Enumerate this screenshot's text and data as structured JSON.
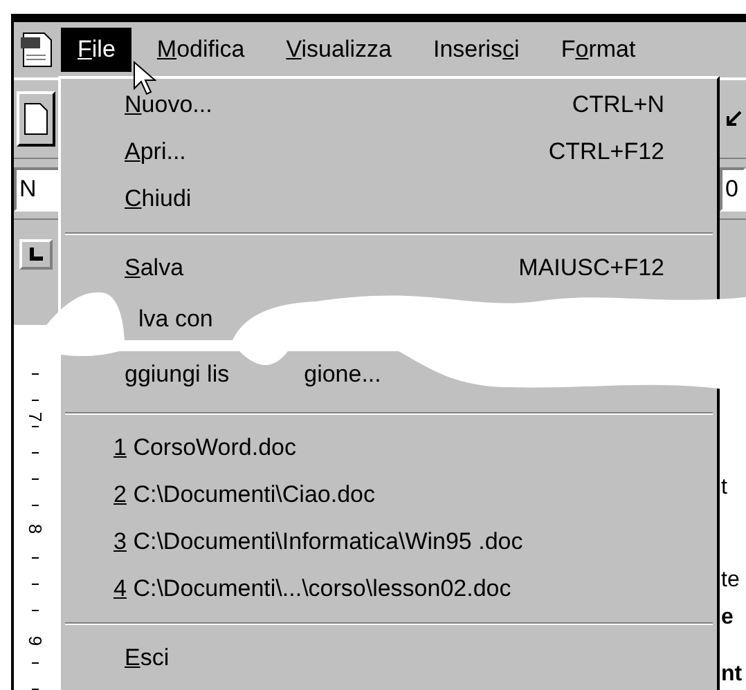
{
  "menubar": {
    "items": [
      {
        "key": "F",
        "after": "ile",
        "selected": true
      },
      {
        "key": "M",
        "after": "odifica",
        "selected": false
      },
      {
        "key": "V",
        "after": "isualizza",
        "selected": false
      },
      {
        "before": "Inseris",
        "key": "c",
        "after": "i",
        "selected": false
      },
      {
        "before": "F",
        "key": "o",
        "after": "rmat",
        "selected": false
      }
    ]
  },
  "file_menu": {
    "items": [
      {
        "kind": "command",
        "key": "N",
        "after": "uovo...",
        "shortcut": "CTRL+N"
      },
      {
        "kind": "command",
        "key": "A",
        "after": "pri...",
        "shortcut": "CTRL+F12"
      },
      {
        "kind": "command",
        "key": "C",
        "after": "hiudi"
      },
      {
        "kind": "separator"
      },
      {
        "kind": "command",
        "key": "S",
        "after": "alva",
        "shortcut": "MAIUSC+F12"
      },
      {
        "kind": "torn",
        "fragments": [
          "lva con"
        ]
      },
      {
        "kind": "torn",
        "fragments": [
          "ggiungi lis",
          "gione..."
        ]
      },
      {
        "kind": "separator"
      },
      {
        "kind": "recent",
        "key": "1",
        "after": " CorsoWord.doc"
      },
      {
        "kind": "recent",
        "key": "2",
        "after": " C:\\Documenti\\Ciao.doc"
      },
      {
        "kind": "recent",
        "key": "3",
        "after": " C:\\Documenti\\Informatica\\Win95 .doc"
      },
      {
        "kind": "recent",
        "key": "4",
        "after": " C:\\Documenti\\...\\corso\\lesson02.doc"
      },
      {
        "kind": "separator"
      },
      {
        "kind": "command",
        "key": "E",
        "after": "sci"
      }
    ]
  },
  "toolbar": {
    "style_field": "N",
    "size_field": "0"
  },
  "ruler": {
    "numbers": [
      "7",
      "8",
      "9"
    ]
  },
  "document": {
    "fragments": [
      {
        "text": "t",
        "bold": false
      },
      {
        "text": "te",
        "bold": false
      },
      {
        "text": "e",
        "bold": true
      },
      {
        "text": "nt",
        "bold": true
      }
    ]
  }
}
